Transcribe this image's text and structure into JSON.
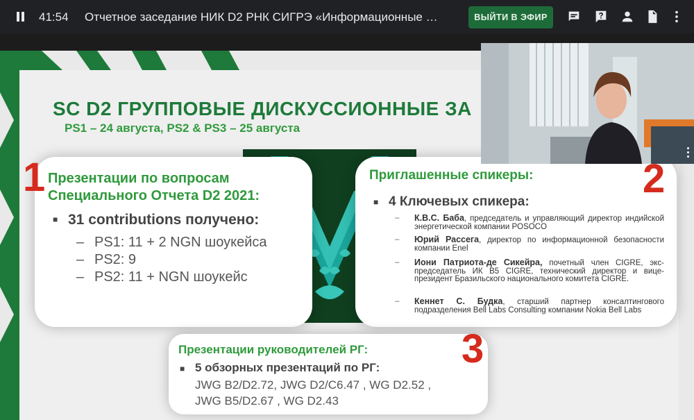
{
  "topbar": {
    "timer": "41:54",
    "title": "Отчетное заседание НИК D2 РНК СИГРЭ «Информационные …",
    "live_label": "ВЫЙТИ В ЭФИР",
    "icons": [
      "pause-icon",
      "chat-icon",
      "question-icon",
      "person-icon",
      "document-icon",
      "more-vert-icon"
    ]
  },
  "slide": {
    "title": "SC D2 ГРУППОВЫЕ ДИСКУССИОННЫЕ ЗА",
    "subtitle": "PS1 – 24 августа, PS2 & PS3 – 25 августа",
    "card1": {
      "number": "1",
      "heading_line1": "Презентации по вопросам",
      "heading_line2": "Специального Отчета D2 2021:",
      "bullet": "31 contributions получено:",
      "items": [
        "PS1: 11 + 2 NGN шоукейса",
        "PS2: 9",
        "PS2: 11 + NGN шоукейс"
      ]
    },
    "card2": {
      "number": "2",
      "heading": "Приглашенные спикеры:",
      "bullet": "4 Ключевых спикера:",
      "speakers": [
        {
          "name": "К.В.С. Баба",
          "desc": ", председатель и управляющий директор индийской энергетической компании POSOCO"
        },
        {
          "name": "Юрий Рассега",
          "desc": ", директор по информационной безопасности компании Enel"
        },
        {
          "name": "Иони Патриота-де Сикейра,",
          "desc": " почетный член CIGRE, экс-председатель ИК B5 CIGRE, технический директор и вице-президент Бразильского национального комитета CIGRE."
        },
        {
          "name": "Кеннет С. Будка",
          "desc": ", старший партнер консалтингового подразделения Bell Labs Consulting компании Nokia Bell Labs"
        }
      ]
    },
    "card3": {
      "number": "3",
      "heading": "Презентации руководителей РГ:",
      "bullet": "5 обзорных презентаций по РГ:",
      "line1": "JWG B2/D2.72, JWG D2/C6.47 , WG D2.52 ,",
      "line2": "JWG B5/D2.67 , WG D2.43"
    }
  },
  "colors": {
    "brand_green": "#1e7a3a",
    "live_button": "#1e6b3a",
    "accent_red": "#d52b1e",
    "heading_green": "#2f9a3c"
  }
}
